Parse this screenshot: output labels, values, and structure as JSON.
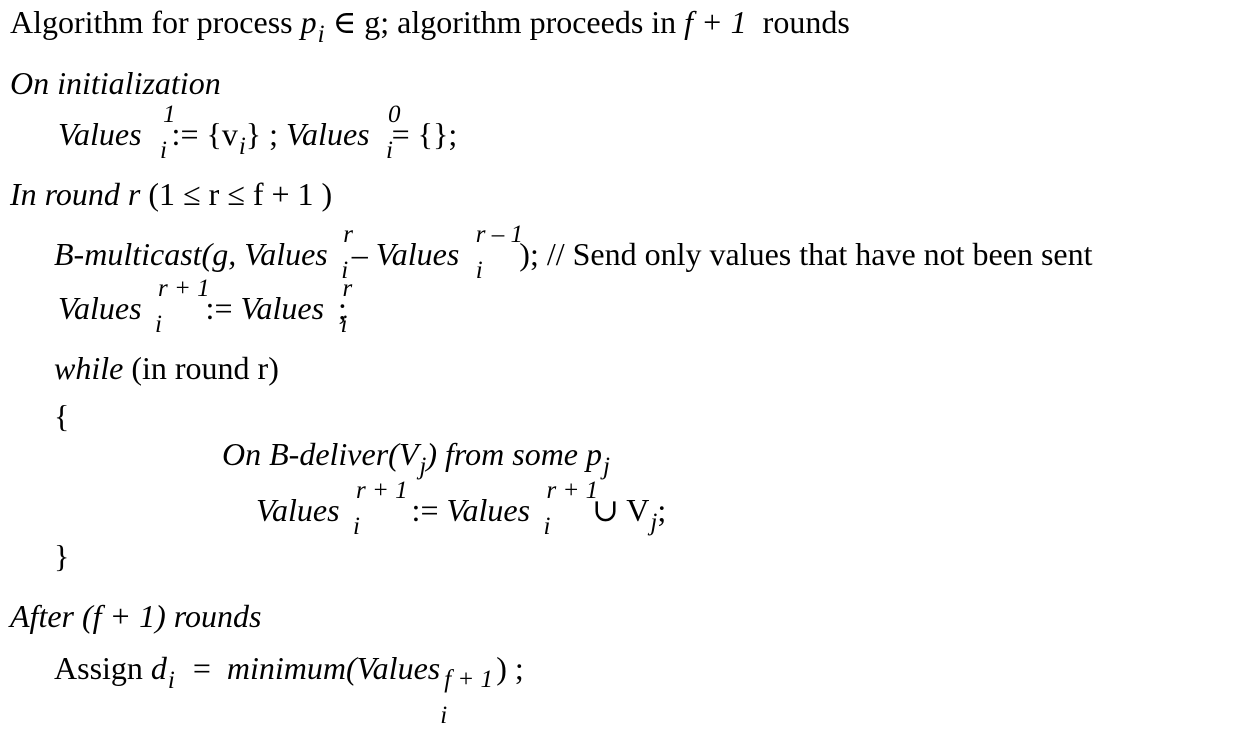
{
  "header": {
    "title_prefix": "Algorithm for process",
    "p": "p",
    "i": "i",
    "elem_g": "∈ g",
    "title_suffix": "; algorithm proceeds in",
    "f_plus_1": "f + 1",
    "rounds": "rounds"
  },
  "init": {
    "heading": "On initialization",
    "values": "Values",
    "i": "i",
    "sup1": "1",
    "sup0": "0",
    "assign_v": ":= {v",
    "close_v": "} ;",
    "empty": "= {};"
  },
  "round": {
    "heading_it": "In round r",
    "condition": "(1 ≤ r ≤ f + 1 )",
    "multicast_fn": "B-multicast(g,",
    "values": "Values",
    "i": "i",
    "sup_r": "r",
    "minus": "–",
    "sup_r_minus_1": "r – 1",
    "multicast_close": "); // Send only values that have not been sent",
    "sup_r_plus_1": "r + 1",
    "assign": ":=",
    "semicolon": ";",
    "while_kw": "while",
    "while_cond": "(in round r)",
    "open_brace": "{",
    "deliver_on": "On B-deliver(V",
    "j": "j",
    "deliver_from": ") from some p",
    "union_assign": ":=",
    "union": "∪ V",
    "union_end": ";",
    "close_brace": "}"
  },
  "after": {
    "heading_it1": "After",
    "f_plus_1": "(f + 1)",
    "heading_it2": "rounds",
    "assign_text": "Assign",
    "d": "d",
    "i": "i",
    "eq": "=",
    "minimum": "minimum(Values",
    "sup_f1": "f + 1",
    "close": ") ;"
  }
}
